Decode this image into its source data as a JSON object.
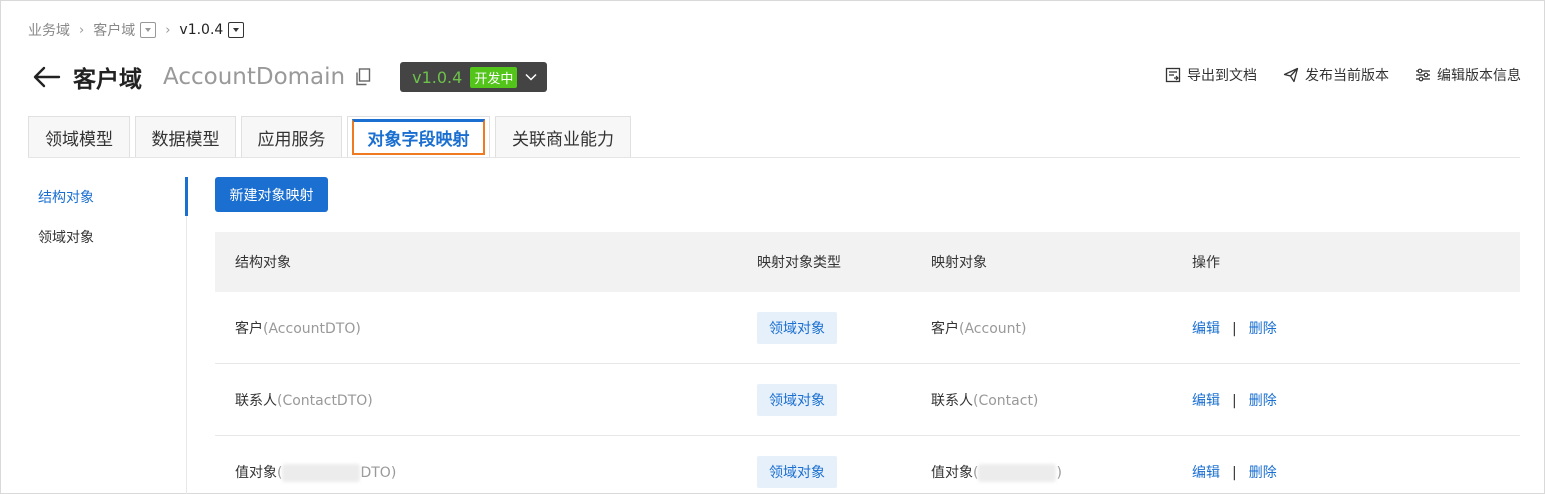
{
  "breadcrumb": {
    "items": [
      "业务域",
      "客户域",
      "v1.0.4"
    ]
  },
  "header": {
    "title": "客户域",
    "subtitle": "AccountDomain",
    "version": "v1.0.4",
    "version_status": "开发中"
  },
  "actions": {
    "export": "导出到文档",
    "publish": "发布当前版本",
    "edit_version": "编辑版本信息"
  },
  "tabs": [
    {
      "label": "领域模型"
    },
    {
      "label": "数据模型"
    },
    {
      "label": "应用服务"
    },
    {
      "label": "对象字段映射"
    },
    {
      "label": "关联商业能力"
    }
  ],
  "sidebar": {
    "items": [
      {
        "label": "结构对象"
      },
      {
        "label": "领域对象"
      }
    ]
  },
  "main": {
    "new_button": "新建对象映射",
    "columns": [
      "结构对象",
      "映射对象类型",
      "映射对象",
      "操作"
    ],
    "rows": [
      {
        "obj_name": "客户",
        "obj_code": "(AccountDTO)",
        "type": "领域对象",
        "map_name": "客户",
        "map_code": "(Account)",
        "edit": "编辑",
        "sep": "|",
        "delete": "删除"
      },
      {
        "obj_name": "联系人",
        "obj_code": "(ContactDTO)",
        "type": "领域对象",
        "map_name": "联系人",
        "map_code": "(Contact)",
        "edit": "编辑",
        "sep": "|",
        "delete": "删除"
      },
      {
        "obj_name": "值对象",
        "obj_code_pre": "(",
        "obj_code_post": "DTO)",
        "type": "领域对象",
        "map_name": "值对象",
        "map_code_pre": "(",
        "map_code_post": ")",
        "edit": "编辑",
        "sep": "|",
        "delete": "删除"
      }
    ]
  },
  "colors": {
    "primary": "#1a6fd0",
    "active_tab_outline": "#f07a20",
    "status_green": "#52c41a",
    "version_bg": "#444444"
  }
}
